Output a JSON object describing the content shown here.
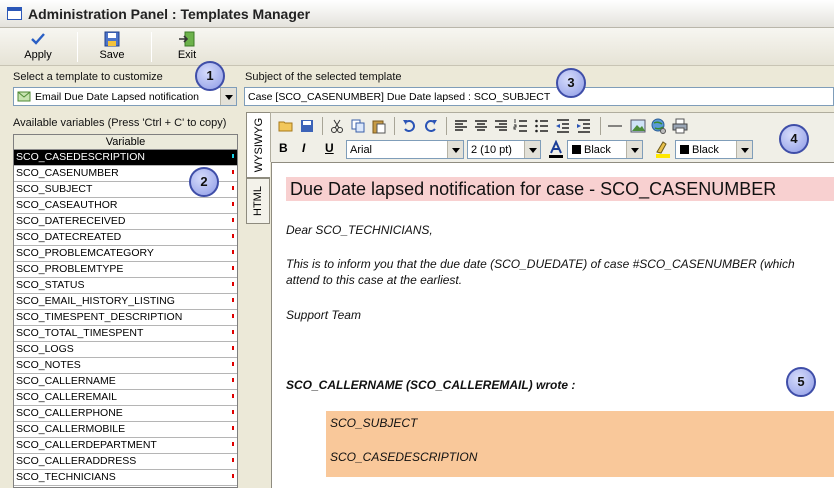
{
  "window": {
    "title": "Administration Panel : Templates Manager"
  },
  "toolbar": {
    "apply": "Apply",
    "save": "Save",
    "exit": "Exit"
  },
  "template_select": {
    "label": "Select a template to customize",
    "value": "Email Due Date Lapsed notification"
  },
  "subject": {
    "label": "Subject of the selected template",
    "value": "Case [SCO_CASENUMBER] Due Date lapsed : SCO_SUBJECT"
  },
  "variables": {
    "label": "Available variables (Press 'Ctrl + C' to copy)",
    "column": "Variable",
    "items": [
      "SCO_CASEDESCRIPTION",
      "SCO_CASENUMBER",
      "SCO_SUBJECT",
      "SCO_CASEAUTHOR",
      "SCO_DATERECEIVED",
      "SCO_DATECREATED",
      "SCO_PROBLEMCATEGORY",
      "SCO_PROBLEMTYPE",
      "SCO_STATUS",
      "SCO_EMAIL_HISTORY_LISTING",
      "SCO_TIMESPENT_DESCRIPTION",
      "SCO_TOTAL_TIMESPENT",
      "SCO_LOGS",
      "SCO_NOTES",
      "SCO_CALLERNAME",
      "SCO_CALLEREMAIL",
      "SCO_CALLERPHONE",
      "SCO_CALLERMOBILE",
      "SCO_CALLERDEPARTMENT",
      "SCO_CALLERADDRESS",
      "SCO_TECHNICIANS"
    ]
  },
  "tabs": {
    "wysiwyg": "WYSIWYG",
    "html": "HTML"
  },
  "format": {
    "bold": "B",
    "italic": "I",
    "underline": "U",
    "font": "Arial",
    "size": "2 (10 pt)",
    "fore_color": "Black",
    "back_color": "Black"
  },
  "document": {
    "heading": "Due Date lapsed notification for case - SCO_CASENUMBER",
    "greeting": "Dear SCO_TECHNICIANS,",
    "line1": "This is to inform you that the due date (SCO_DUEDATE) of case #SCO_CASENUMBER (which",
    "line2": "attend to this case at the earliest.",
    "signature": "Support Team",
    "wrote": "SCO_CALLERNAME (SCO_CALLEREMAIL) wrote :",
    "quote1": "SCO_SUBJECT",
    "quote2": "SCO_CASEDESCRIPTION"
  },
  "callouts": [
    "1",
    "2",
    "3",
    "4",
    "5"
  ]
}
